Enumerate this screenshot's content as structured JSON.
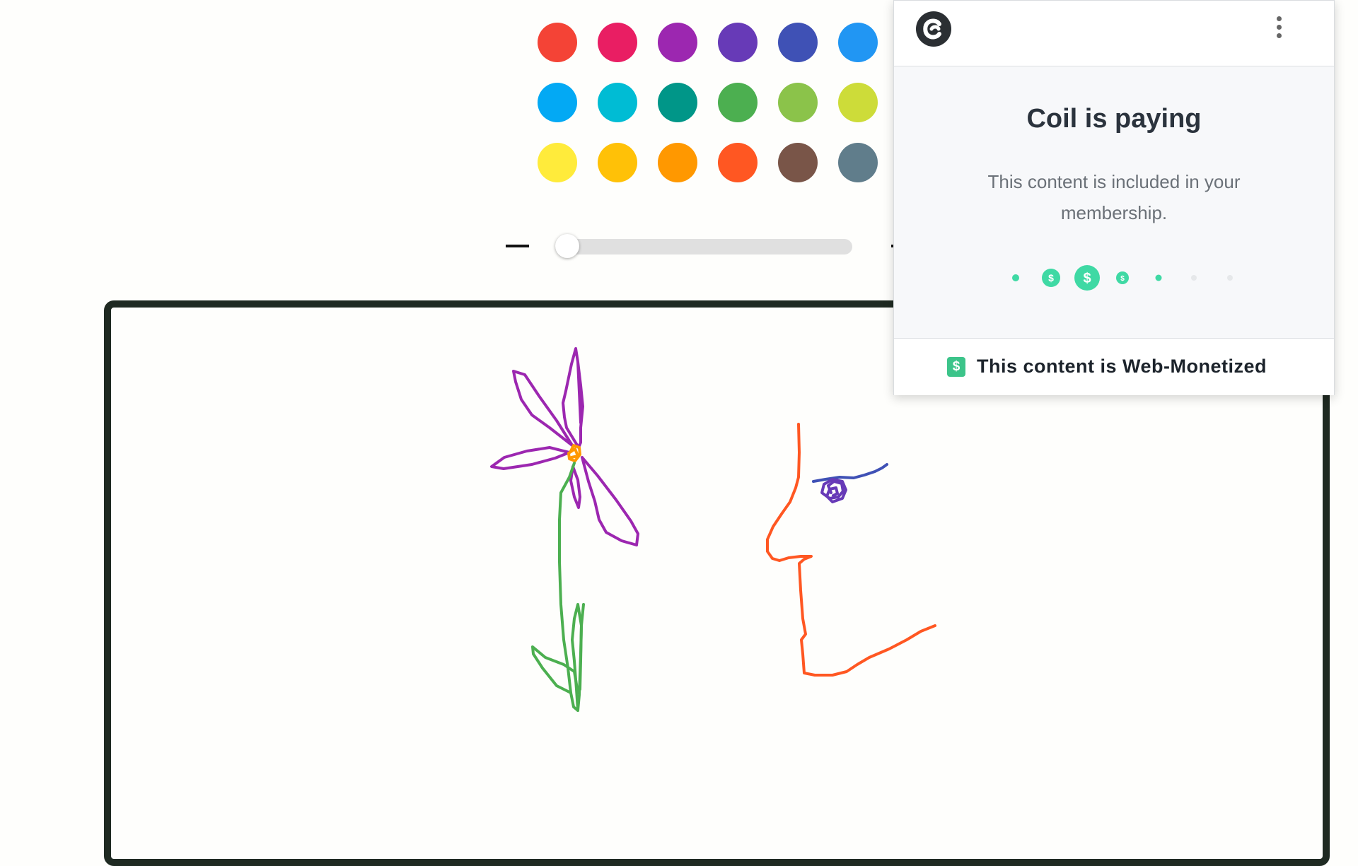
{
  "palette": {
    "colors": [
      "#f44336",
      "#e91e63",
      "#9c27b0",
      "#673ab7",
      "#3f51b5",
      "#2196f3",
      "#03a9f4",
      "#00bcd4",
      "#009688",
      "#4caf50",
      "#8bc34a",
      "#cddc39",
      "#ffeb3b",
      "#ffc107",
      "#ff9800",
      "#ff5722",
      "#795548",
      "#607d8b"
    ]
  },
  "brush_size": {
    "minus_icon": "minus-icon",
    "plus_icon": "plus-icon",
    "level": 0.04
  },
  "canvas": {
    "border_color": "#1f2a22",
    "stroke_colors": {
      "petals": "#9c27b0",
      "center": "#ff9800",
      "stem": "#4caf50",
      "face": "#ff5722",
      "eyebrow": "#3f51b5",
      "eye": "#673ab7"
    }
  },
  "coil": {
    "logo_icon": "coil-logo-icon",
    "menu_icon": "kebab-menu-icon",
    "title": "Coil is paying",
    "description": "This content is included in your membership.",
    "accent": "#3fd9a4",
    "footer_icon": "dollar-icon",
    "footer_icon_glyph": "$",
    "footer_text": "This content is Web-Monetized"
  }
}
